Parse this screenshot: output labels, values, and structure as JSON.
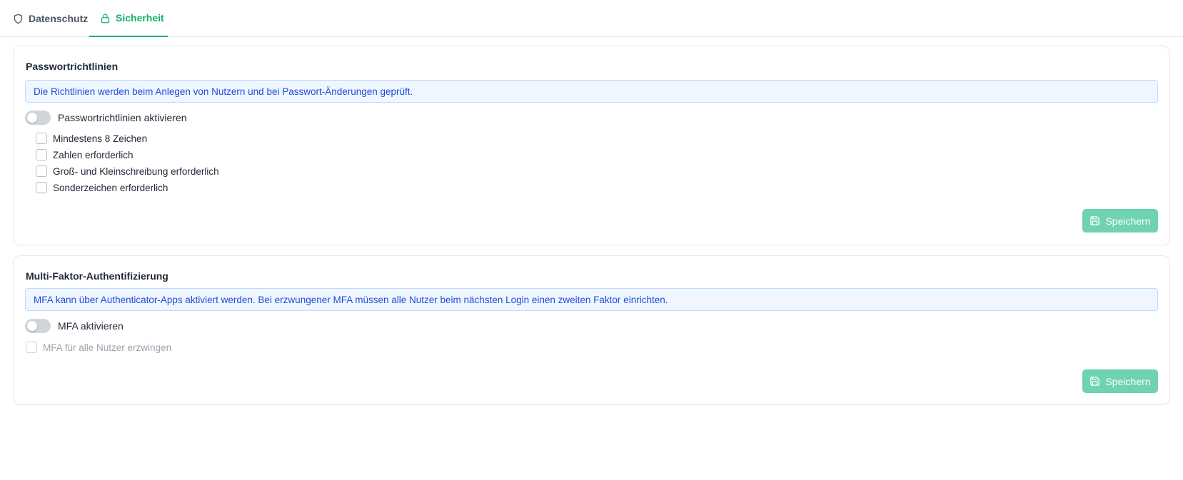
{
  "tabs": [
    {
      "label": "Datenschutz",
      "icon": "shield-icon",
      "active": false
    },
    {
      "label": "Sicherheit",
      "icon": "lock-icon",
      "active": true
    }
  ],
  "colors": {
    "accent": "#10b26c",
    "info_bg": "#eff6ff",
    "info_text": "#1d4ed8",
    "save_button_bg": "#6ed3ae"
  },
  "password_policy": {
    "title": "Passwortrichtlinien",
    "info": "Die Richtlinien werden beim Anlegen von Nutzern und bei Passwort-Änderungen geprüft.",
    "toggle_label": "Passwortrichtlinien aktivieren",
    "toggle_on": false,
    "rules": [
      {
        "label": "Mindestens 8 Zeichen",
        "checked": false
      },
      {
        "label": "Zahlen erforderlich",
        "checked": false
      },
      {
        "label": "Groß- und Kleinschreibung erforderlich",
        "checked": false
      },
      {
        "label": "Sonderzeichen erforderlich",
        "checked": false
      }
    ],
    "save_label": "Speichern",
    "save_icon": "save-icon"
  },
  "mfa": {
    "title": "Multi-Faktor-Authentifizierung",
    "info": "MFA kann über Authenticator-Apps aktiviert werden. Bei erzwungener MFA müssen alle Nutzer beim nächsten Login einen zweiten Faktor einrichten.",
    "toggle_label": "MFA aktivieren",
    "toggle_on": false,
    "enforce_label": "MFA für alle Nutzer erzwingen",
    "enforce_checked": false,
    "enforce_disabled": true,
    "save_label": "Speichern",
    "save_icon": "save-icon"
  }
}
